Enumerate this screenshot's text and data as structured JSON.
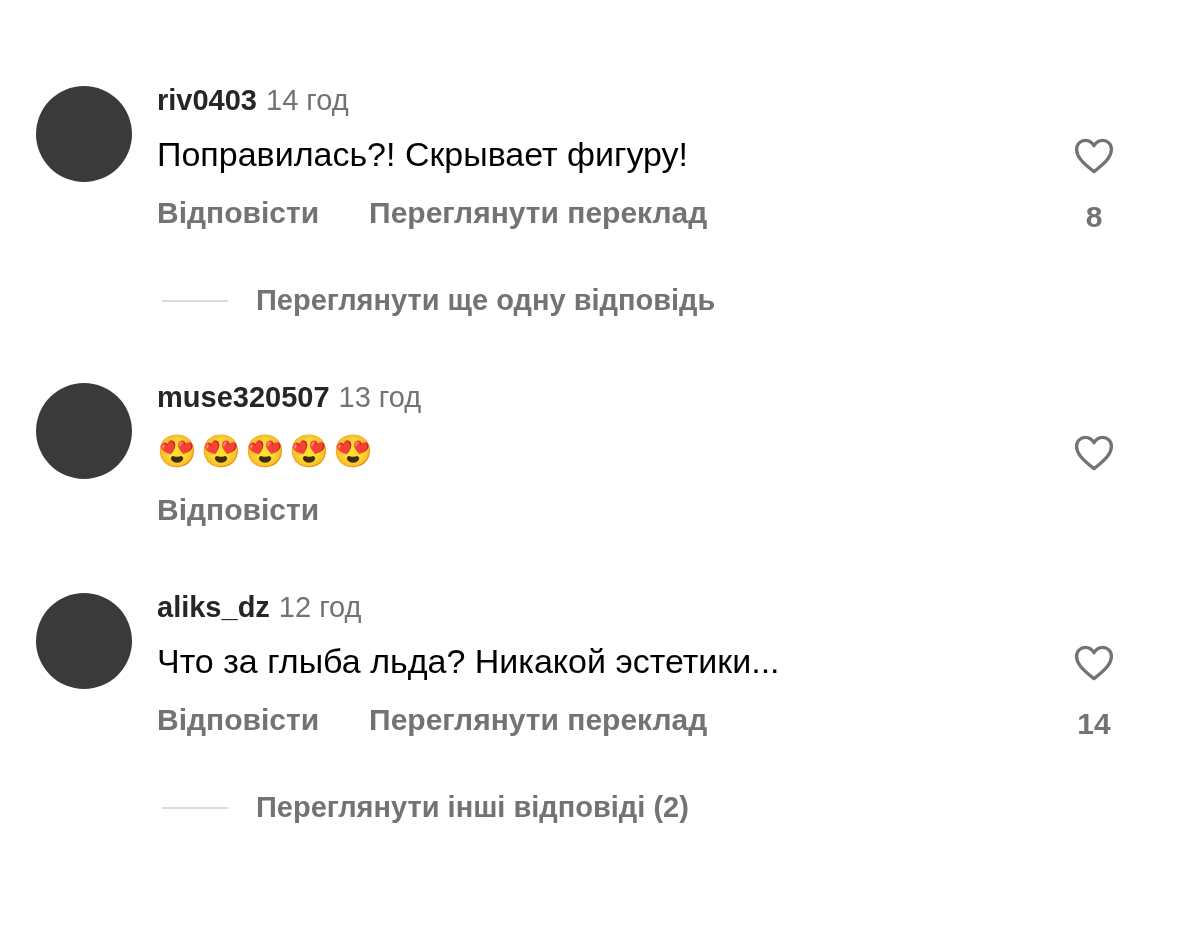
{
  "comments": [
    {
      "username": "riv0403",
      "time": "14 год",
      "text": "Поправилась?! Скрывает фигуру!",
      "kind": "text",
      "liked": false,
      "actions": [
        "Відповісти",
        "Переглянути переклад"
      ],
      "likes": "8",
      "replies_link": "Переглянути ще одну відповідь"
    },
    {
      "username": "muse320507",
      "time": "13 год",
      "text": "😍😍😍😍😍",
      "kind": "emoji",
      "liked": false,
      "actions": [
        "Відповісти"
      ]
    },
    {
      "username": "aliks_dz",
      "time": "12 год",
      "text": "Что за глыба льда? Никакой эстетики...",
      "kind": "text",
      "liked": false,
      "actions": [
        "Відповісти",
        "Переглянути переклад"
      ],
      "likes": "14",
      "replies_link": "Переглянути інші відповіді (2)"
    }
  ]
}
